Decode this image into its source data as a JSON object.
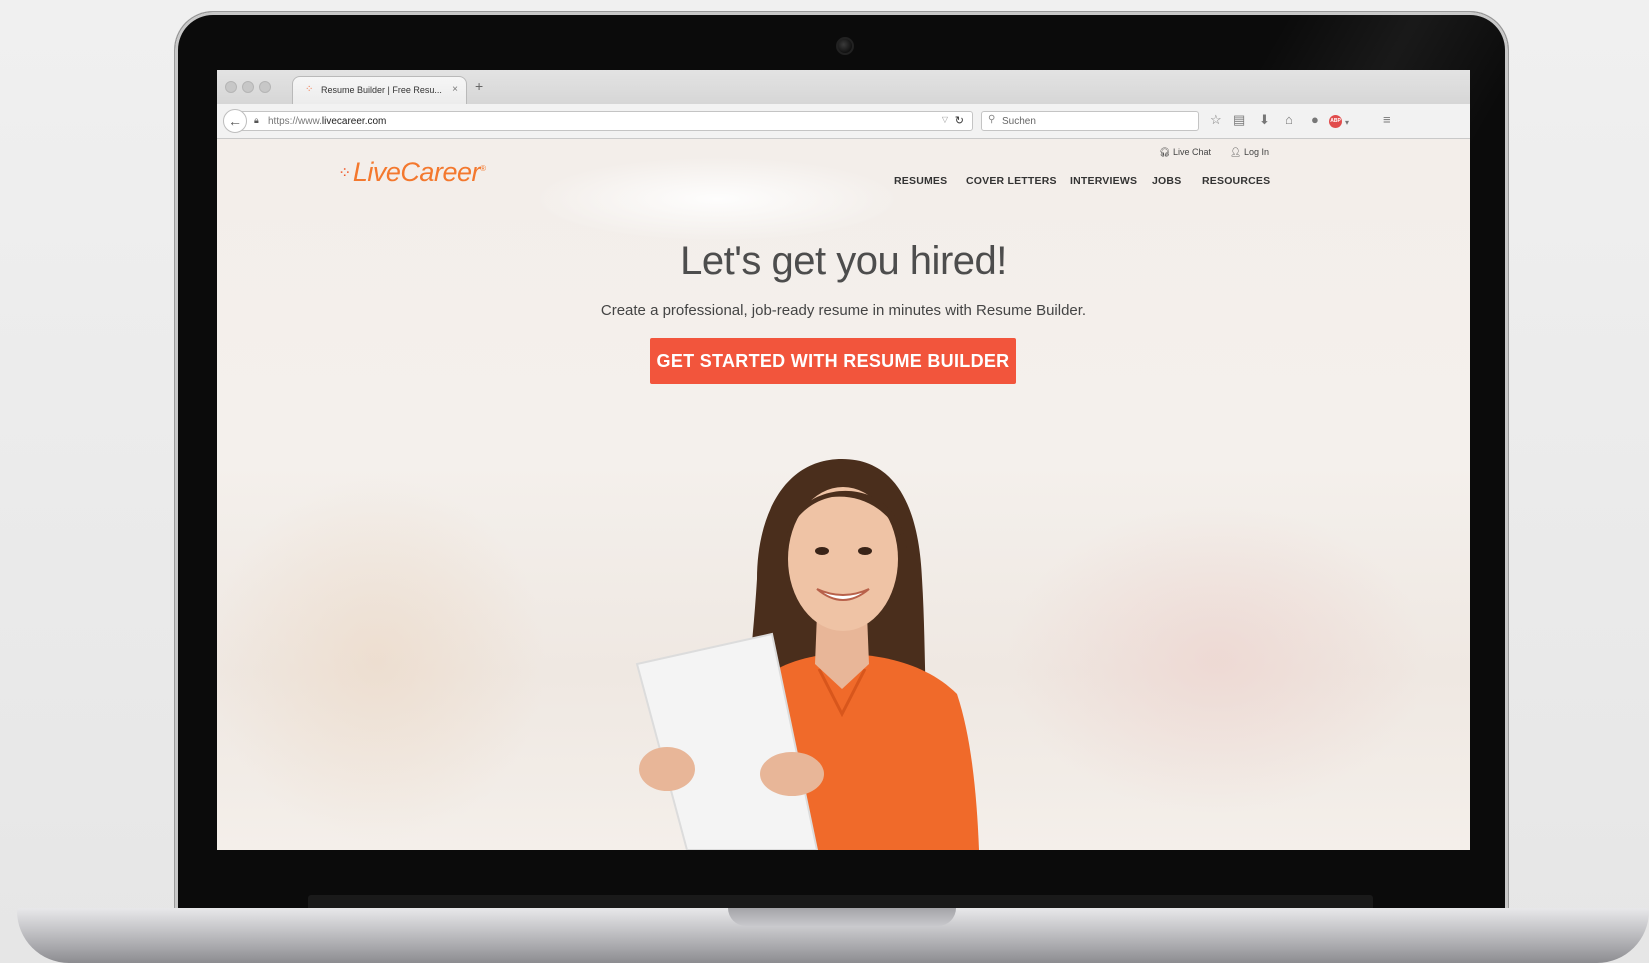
{
  "browser": {
    "tab_title": "Resume Builder | Free Resu...",
    "tab_close": "×",
    "new_tab": "+",
    "url_prefix": "https://www.",
    "url_domain": "livecareer.com",
    "search_placeholder": "Suchen",
    "abp_label": "ABP",
    "icons": [
      "back-icon",
      "lock-icon",
      "reload-icon",
      "search-icon",
      "star-icon",
      "reading-list-icon",
      "download-icon",
      "home-icon",
      "chat-icon",
      "adblock-icon",
      "menu-icon"
    ]
  },
  "site": {
    "logo": "LiveCareer",
    "utility_nav": {
      "live_chat": "Live Chat",
      "log_in": "Log In"
    },
    "nav": [
      "RESUMES",
      "COVER LETTERS",
      "INTERVIEWS",
      "JOBS",
      "RESOURCES"
    ],
    "hero": {
      "title": "Let's get you hired!",
      "subtitle": "Create a professional, job-ready resume in minutes with Resume Builder.",
      "cta": "GET STARTED WITH RESUME BUILDER"
    }
  },
  "colors": {
    "brand_orange": "#f3782e",
    "cta_red": "#f2553c",
    "shirt_orange": "#f06a2a"
  }
}
